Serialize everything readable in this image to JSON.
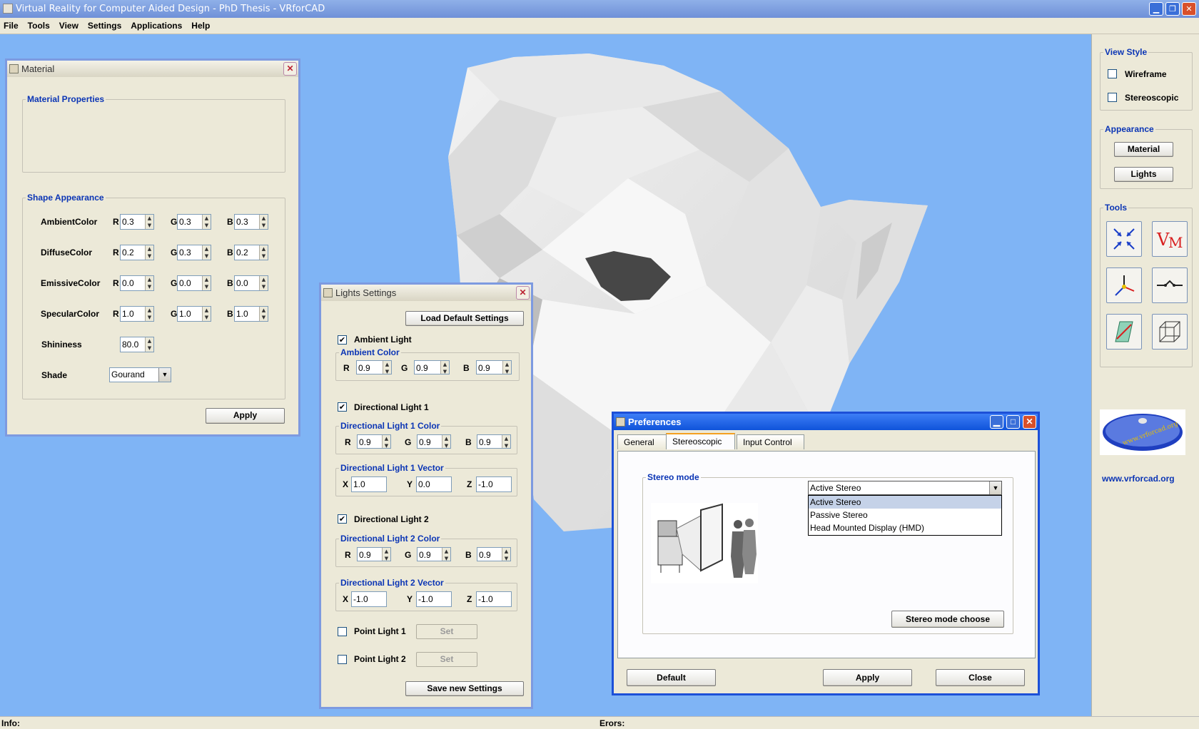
{
  "app": {
    "title": "Virtual Reality for Computer Aided Design - PhD Thesis  - VRforCAD",
    "window_buttons": {
      "minimize": "▁",
      "restore": "❐",
      "close": "✕"
    }
  },
  "menu": [
    "File",
    "Tools",
    "View",
    "Settings",
    "Applications",
    "Help"
  ],
  "status": {
    "info": "Info:",
    "errors": "Erors:"
  },
  "right_panel": {
    "view_style": {
      "title": "View Style",
      "wireframe": "Wireframe",
      "stereoscopic": "Stereoscopic"
    },
    "appearance": {
      "title": "Appearance",
      "material": "Material",
      "lights": "Lights"
    },
    "tools": {
      "title": "Tools",
      "icons": [
        "collapse-arrows-icon",
        "vm-icon",
        "axes-icon",
        "line-tool-icon",
        "plane-section-icon",
        "cube-wireframe-icon"
      ]
    },
    "logo_text": "www.vrforcad.org"
  },
  "material": {
    "title": "Material",
    "properties_title": "Material Properties",
    "shape_title": "Shape Appearance",
    "rows": [
      {
        "label": "AmbientColor",
        "r": "0.3",
        "g": "0.3",
        "b": "0.3"
      },
      {
        "label": "DiffuseColor",
        "r": "0.2",
        "g": "0.3",
        "b": "0.2"
      },
      {
        "label": "EmissiveColor",
        "r": "0.0",
        "g": "0.0",
        "b": "0.0"
      },
      {
        "label": "SpecularColor",
        "r": "1.0",
        "g": "1.0",
        "b": "1.0"
      }
    ],
    "channel": {
      "r": "R",
      "g": "G",
      "b": "B"
    },
    "shininess_label": "Shininess",
    "shininess": "80.0",
    "shade_label": "Shade",
    "shade": "Gourand",
    "apply": "Apply"
  },
  "lights": {
    "title": "Lights Settings",
    "load_default": "Load Default Settings",
    "ambient": {
      "label": "Ambient Light",
      "color_title": "Ambient Color",
      "r": "0.9",
      "g": "0.9",
      "b": "0.9"
    },
    "dir1": {
      "label": "Directional Light 1",
      "color_title": "Directional Light 1 Color",
      "r": "0.9",
      "g": "0.9",
      "b": "0.9",
      "vector_title": "Directional Light 1 Vector",
      "x": "1.0",
      "y": "0.0",
      "z": "-1.0"
    },
    "dir2": {
      "label": "Directional Light 2",
      "color_title": "Directional Light 2 Color",
      "r": "0.9",
      "g": "0.9",
      "b": "0.9",
      "vector_title": "Directional Light 2 Vector",
      "x": "-1.0",
      "y": "-1.0",
      "z": "-1.0"
    },
    "channel": {
      "r": "R",
      "g": "G",
      "b": "B",
      "x": "X",
      "y": "Y",
      "z": "Z"
    },
    "point1": {
      "label": "Point Light 1",
      "set": "Set"
    },
    "point2": {
      "label": "Point Light 2",
      "set": "Set"
    },
    "save": "Save new Settings",
    "checked_mark": "✔"
  },
  "preferences": {
    "title": "Preferences",
    "tabs": [
      "General",
      "Stereoscopic",
      "Input Control"
    ],
    "stereo_mode_title": "Stereo mode",
    "selected": "Active Stereo",
    "options": [
      "Active Stereo",
      "Passive Stereo",
      "Head Mounted Display (HMD)"
    ],
    "choose": "Stereo mode choose",
    "default": "Default",
    "apply": "Apply",
    "close": "Close"
  }
}
